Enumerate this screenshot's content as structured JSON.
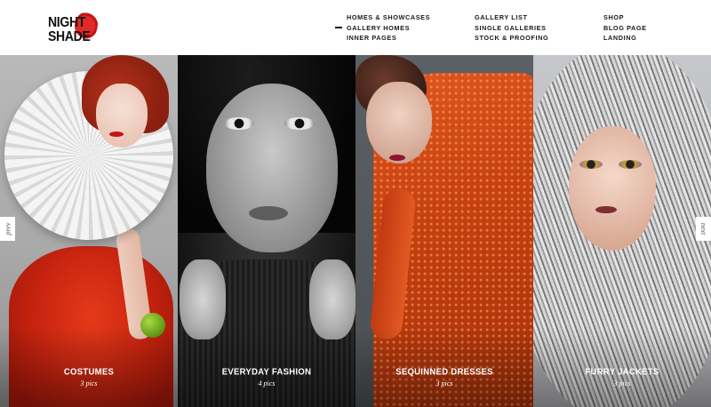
{
  "logo": {
    "line1": "NIGHT",
    "line2": "SHADE",
    "accent_color": "#e02a2a"
  },
  "menu": {
    "columns": [
      {
        "items": [
          {
            "label": "Homes & Showcases"
          },
          {
            "label": "Gallery Homes",
            "active": true
          },
          {
            "label": "Inner Pages"
          }
        ]
      },
      {
        "items": [
          {
            "label": "Gallery List"
          },
          {
            "label": "Single Galleries"
          },
          {
            "label": "Stock & Proofing"
          }
        ]
      },
      {
        "items": [
          {
            "label": "Shop"
          },
          {
            "label": "Blog Page"
          },
          {
            "label": "Landing"
          }
        ]
      }
    ]
  },
  "gallery": {
    "panels": [
      {
        "title": "COSTUMES",
        "count": "3 pics"
      },
      {
        "title": "EVERYDAY FASHION",
        "count": "4 pics"
      },
      {
        "title": "SEQUINNED DRESSES",
        "count": "3 pics"
      },
      {
        "title": "FURRY JACKETS",
        "count": "3 pics"
      }
    ]
  },
  "nav": {
    "prev_label": "prev",
    "next_label": "next"
  }
}
